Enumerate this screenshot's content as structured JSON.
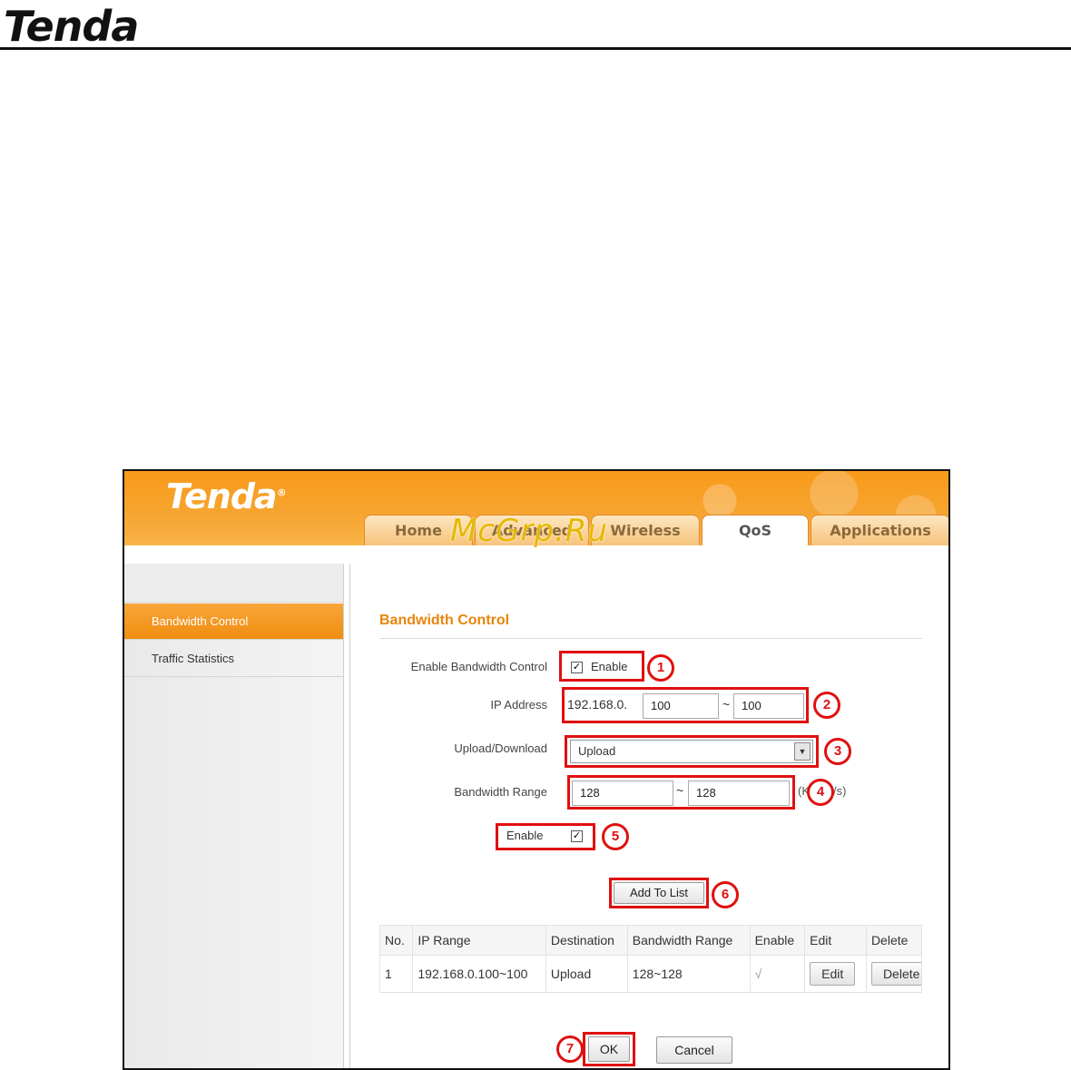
{
  "document": {
    "logo": "Tenda"
  },
  "app": {
    "brand": "Tenda",
    "brand_mark": "®",
    "tabs": [
      {
        "label": "Home",
        "active": false
      },
      {
        "label": "Advanced",
        "active": false
      },
      {
        "label": "Wireless",
        "active": false
      },
      {
        "label": "QoS",
        "active": true
      },
      {
        "label": "Applications",
        "active": false
      }
    ]
  },
  "sidebar": {
    "items": [
      {
        "label": "Bandwidth Control",
        "active": true
      },
      {
        "label": "Traffic Statistics",
        "active": false
      }
    ]
  },
  "form": {
    "title": "Bandwidth Control",
    "enable_label": "Enable Bandwidth Control",
    "enable_text": "Enable",
    "enable_checked": "✓",
    "ip_label": "IP Address",
    "ip_prefix": "192.168.0.",
    "ip_start": "100",
    "ip_tilde": "~",
    "ip_end": "100",
    "dir_label": "Upload/Download",
    "dir_value": "Upload",
    "range_label": "Bandwidth Range",
    "range_start": "128",
    "range_tilde": "~",
    "range_end": "128",
    "range_unit": "(KByte/s)",
    "rule_enable_text": "Enable",
    "rule_enable_checked": "✓",
    "add_button": "Add To List",
    "ok_button": "OK",
    "cancel_button": "Cancel"
  },
  "annotations": [
    "1",
    "2",
    "3",
    "4",
    "5",
    "6",
    "7"
  ],
  "table": {
    "headers": [
      "No.",
      "IP Range",
      "Destination",
      "Bandwidth Range",
      "Enable",
      "Edit",
      "Delete"
    ],
    "rows": [
      {
        "no": "1",
        "ip_range": "192.168.0.100~100",
        "destination": "Upload",
        "bandwidth": "128~128",
        "enable": "√",
        "edit": "Edit",
        "delete": "Delete"
      }
    ]
  },
  "watermark": "McGrp.Ru",
  "colors": {
    "accent": "#f08d10",
    "annotation": "#e01010",
    "title": "#e8850c"
  }
}
